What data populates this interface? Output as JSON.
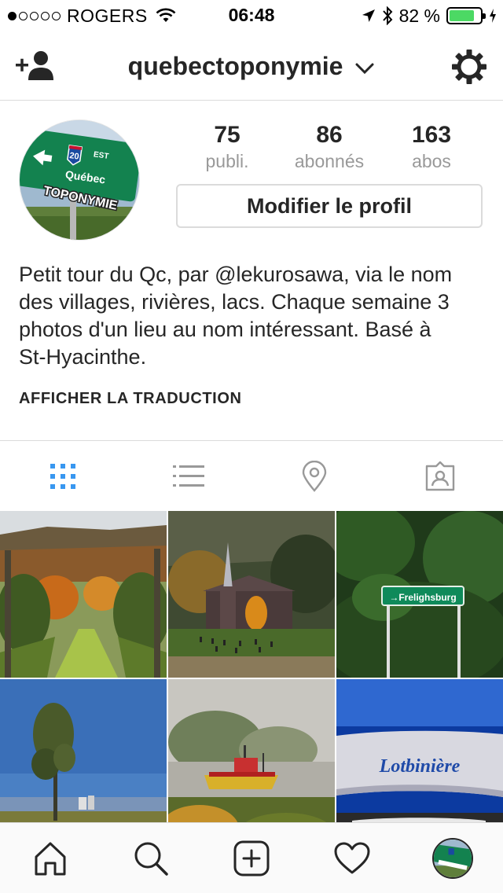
{
  "status_bar": {
    "carrier": "ROGERS",
    "signal_dots_filled": 1,
    "signal_dots_total": 5,
    "time": "06:48",
    "battery_percent": "82 %",
    "battery_level": 0.82,
    "icons": [
      "wifi-icon",
      "location-arrow-icon",
      "bluetooth-icon",
      "battery-icon",
      "charging-bolt-icon"
    ]
  },
  "header": {
    "username": "quebectoponymie",
    "add_user_icon": "add-person-icon",
    "dropdown_icon": "chevron-down-icon",
    "settings_icon": "gear-icon"
  },
  "profile": {
    "avatar_sign_text": "Québec",
    "avatar_highway_number": "20",
    "avatar_highway_direction": "EST",
    "avatar_banner": "TOPONYMIE",
    "stats": [
      {
        "value": "75",
        "label": "publi."
      },
      {
        "value": "86",
        "label": "abonnés"
      },
      {
        "value": "163",
        "label": "abos"
      }
    ],
    "edit_button": "Modifier le profil",
    "bio_lines": [
      "Petit tour du Qc, par @lekurosawa, via le nom",
      "des villages, rivières, lacs. Chaque semaine 3",
      "photos d'un lieu au nom intéressant. Basé à",
      "St-Hyacinthe."
    ],
    "translate_link": "AFFICHER LA TRADUCTION"
  },
  "view_tabs": {
    "items": [
      "grid-view-icon",
      "list-view-icon",
      "location-pin-icon",
      "tagged-photos-icon"
    ],
    "active": 0,
    "active_color": "#3897f0",
    "inactive_color": "#999999"
  },
  "photos": {
    "sign_freleighsburg": "→Frelighsburg",
    "sign_lotbiniere": "Lotbinière"
  },
  "tab_bar": {
    "items": [
      "home-icon",
      "search-icon",
      "new-post-icon",
      "activity-heart-icon",
      "profile-avatar-icon"
    ]
  },
  "colors": {
    "text": "#262626",
    "muted": "#999999",
    "border": "#dbdbdb",
    "battery_green": "#4cd964",
    "accent_blue": "#3897f0"
  }
}
